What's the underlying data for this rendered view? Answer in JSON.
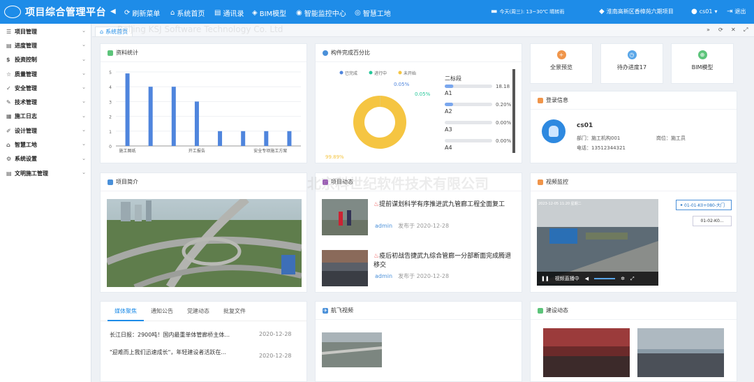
{
  "topbar": {
    "title": "项目综合管理平台",
    "nav": [
      "刷新菜单",
      "系统首页",
      "通讯录",
      "BIM模型",
      "智能监控中心",
      "智慧工地"
    ],
    "date": "今天(周三): 13~30℃ 晴转雨",
    "project": "淮南高新区香樟苑六期项目",
    "user": "cs01",
    "logout": "退出"
  },
  "sidebar": {
    "items": [
      "项目管理",
      "进度管理",
      "投资控制",
      "质量管理",
      "安全管理",
      "技术管理",
      "施工日志",
      "设计管理",
      "智慧工地",
      "系统设置",
      "文明施工管理"
    ]
  },
  "tabs": {
    "active": "系统首页"
  },
  "stats": {
    "title": "资料统计"
  },
  "chart_data": [
    {
      "type": "bar",
      "title": "资料统计",
      "categories": [
        "施工图纸",
        "",
        "",
        "开工报告",
        "",
        "",
        "安全专项施工方案",
        ""
      ],
      "values": [
        4.9,
        4,
        4,
        3,
        1,
        1,
        1,
        1
      ],
      "ylim": [
        0,
        5
      ],
      "yticks": [
        0,
        1,
        2,
        3,
        4,
        5
      ],
      "grid": true
    },
    {
      "type": "pie",
      "title": "构件完成百分比",
      "legend": [
        "已完成",
        "进行中",
        "未开始"
      ],
      "slices": [
        {
          "name": "已完成",
          "value": 0.05
        },
        {
          "name": "进行中",
          "value": 0.05
        },
        {
          "name": "未开始",
          "value": 99.89
        }
      ],
      "labels": [
        "0.05%",
        "0.05%",
        "99.89%"
      ],
      "progress": [
        {
          "name": "A1",
          "value": 18.18,
          "label": "18.18"
        },
        {
          "name": "A2",
          "value": 0.2,
          "label": "0.20%"
        },
        {
          "name": "A3",
          "value": 0,
          "label": "0.00%"
        },
        {
          "name": "A4",
          "value": 0,
          "label": "0.00%"
        }
      ],
      "group": "二标段"
    }
  ],
  "quick": [
    {
      "label": "全景预览",
      "color": "#f0954a"
    },
    {
      "label": "待办进度17",
      "color": "#5aa6e8"
    },
    {
      "label": "BIM模型",
      "color": "#5cc47a"
    }
  ],
  "login": {
    "title": "登录信息",
    "name": "cs01",
    "dept": "部门：施工机构001",
    "post": "岗位：施工员",
    "phone": "电话：13512344321"
  },
  "intro": {
    "title": "项目简介"
  },
  "news": {
    "title": "项目动态",
    "items": [
      {
        "title": "提前谋划科学有序推进武九管廊工程全面复工",
        "author": "admin",
        "time": "发布于 2020-12-28"
      },
      {
        "title": "疫后初战告捷武九综合管廊一分部断面完成腾退移交",
        "author": "admin",
        "time": "发布于 2020-12-28"
      }
    ]
  },
  "video": {
    "title": "视频监控",
    "channels": [
      "01-01-K0+080-大门",
      "01-02-K0..."
    ],
    "overlay": "视频直播中",
    "time": "2023-12-05 11:20 星期二"
  },
  "media": {
    "tabs": [
      "媒体聚焦",
      "通知公告",
      "党建动态",
      "批复文件"
    ],
    "items": [
      {
        "title": "长江日报：2900吨！国内最重单体管廊桥主体...",
        "date": "2020-12-28"
      },
      {
        "title": "\"迎难而上我们迅速成长\"，年轻建设者活跃在...",
        "date": "2020-12-28"
      }
    ]
  },
  "aerial": {
    "title": "航飞视频"
  },
  "build": {
    "title": "建设动态"
  },
  "watermark": {
    "cn": "北京科世纪软件技术有限公司",
    "en": "Beijing KSJ Software Technology Co. Ltd"
  }
}
